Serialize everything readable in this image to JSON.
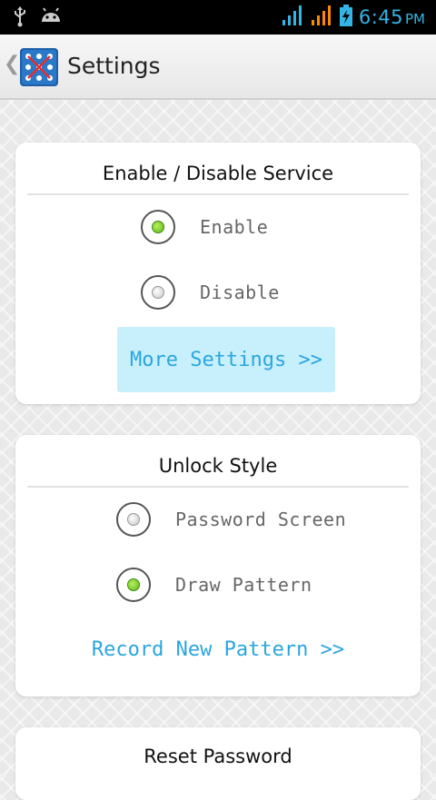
{
  "status_bar": {
    "left_icons": [
      "usb-icon",
      "android-icon"
    ],
    "right_icons": [
      "signal-icon",
      "signal-icon-2",
      "battery-charging-icon"
    ],
    "time": "6:45",
    "ampm": "PM",
    "colors": {
      "background": "#000000",
      "accent": "#33b5e5",
      "signal2": "#ff8800"
    }
  },
  "action_bar": {
    "back_icon": "chevron-left-icon",
    "app_icon": "pattern-lock-app-icon",
    "title": "Settings"
  },
  "service_card": {
    "title": "Enable / Disable Service",
    "options": [
      {
        "label": "Enable",
        "selected": true
      },
      {
        "label": "Disable",
        "selected": false
      }
    ],
    "more_settings_label": "More Settings >>"
  },
  "unlock_card": {
    "title": "Unlock Style",
    "options": [
      {
        "label": "Password Screen",
        "selected": false
      },
      {
        "label": "Draw Pattern",
        "selected": true
      }
    ],
    "record_label": "Record New Pattern >>"
  },
  "reset_card": {
    "title": "Reset Password"
  },
  "colors": {
    "link": "#2ba6de",
    "button_bg": "#c7effc",
    "radio_on": "#7fd32f"
  }
}
